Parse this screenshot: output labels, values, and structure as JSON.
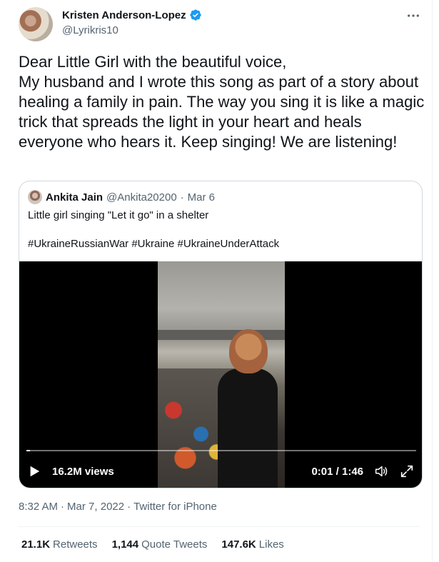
{
  "author": {
    "display_name": "Kristen Anderson-Lopez",
    "handle": "@Lyrikris10",
    "verified": true
  },
  "tweet": {
    "text": "Dear Little Girl with the beautiful voice,\nMy husband and I wrote this song as part of a story about healing a family in pain.  The way you sing it is like a magic trick that spreads the light in your heart and heals everyone who hears it.  Keep singing! We are listening!",
    "time": "8:32 AM",
    "date": "Mar 7, 2022",
    "source": "Twitter for iPhone",
    "sep": "·"
  },
  "quoted": {
    "display_name": "Ankita Jain",
    "handle": "@Ankita20200",
    "sep": "·",
    "date": "Mar 6",
    "text": "Little girl singing \"Let it go\" in a shelter",
    "hashtags": "#UkraineRussianWar #Ukraine #UkraineUnderAttack",
    "video": {
      "views": "16.2M views",
      "time": "0:01 / 1:46",
      "progress_fraction": 0.0094
    }
  },
  "stats": [
    {
      "value": "21.1K",
      "label": "Retweets"
    },
    {
      "value": "1,144",
      "label": "Quote Tweets"
    },
    {
      "value": "147.6K",
      "label": "Likes"
    }
  ],
  "colors": {
    "verified": "#1d9bf0",
    "text_primary": "#0f1419",
    "text_secondary": "#536471",
    "border": "#cfd9de"
  },
  "icons": [
    "more-icon",
    "verified-badge-icon",
    "play-icon",
    "volume-icon",
    "fullscreen-icon"
  ]
}
